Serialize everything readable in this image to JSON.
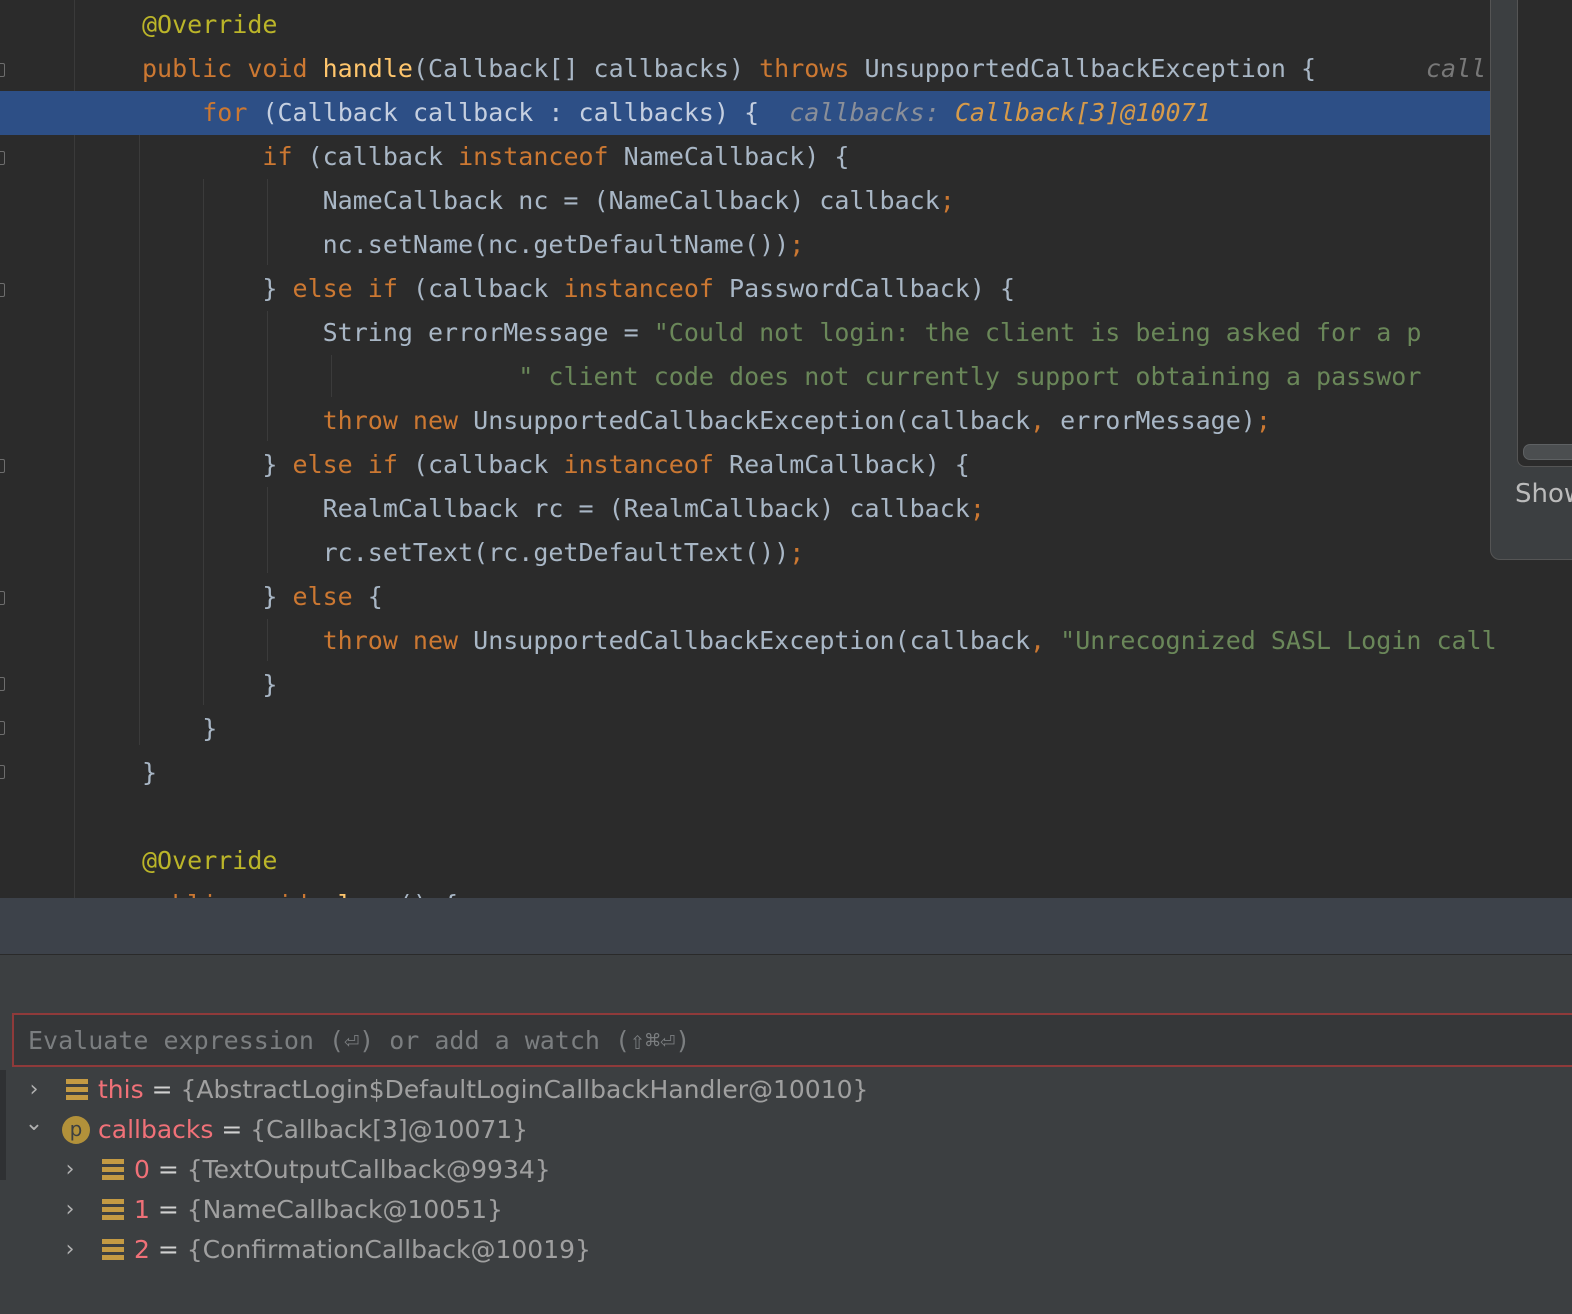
{
  "editor": {
    "lines": [
      {
        "id": "l1",
        "parts": [
          [
            "ann",
            "@Override"
          ]
        ]
      },
      {
        "id": "l2",
        "parts": [
          [
            "kw",
            "public "
          ],
          [
            "kw",
            "void "
          ],
          [
            "fn",
            "handle"
          ],
          [
            "",
            "(Callback[] callbacks) "
          ],
          [
            "kw",
            "throws "
          ],
          [
            "",
            "UnsupportedCallbackException {"
          ]
        ],
        "hint_right": "call"
      },
      {
        "id": "l3",
        "parts": [
          [
            "",
            "    "
          ],
          [
            "kw",
            "for "
          ],
          [
            "",
            "(Callback callback : callbacks) {  "
          ],
          [
            "hint",
            "callbacks: "
          ],
          [
            "hint-val",
            "Callback[3]@10071"
          ]
        ]
      },
      {
        "id": "l4",
        "parts": [
          [
            "",
            "        "
          ],
          [
            "kw",
            "if "
          ],
          [
            "",
            "(callback "
          ],
          [
            "kw",
            "instanceof "
          ],
          [
            "",
            "NameCallback) {"
          ]
        ]
      },
      {
        "id": "l5",
        "parts": [
          [
            "",
            "            NameCallback nc = (NameCallback) callback"
          ],
          [
            "semi",
            ";"
          ]
        ]
      },
      {
        "id": "l6",
        "parts": [
          [
            "",
            "            nc.setName(nc.getDefaultName())"
          ],
          [
            "semi",
            ";"
          ]
        ]
      },
      {
        "id": "l7",
        "parts": [
          [
            "",
            "        } "
          ],
          [
            "kw",
            "else if "
          ],
          [
            "",
            "(callback "
          ],
          [
            "kw",
            "instanceof "
          ],
          [
            "",
            "PasswordCallback) {"
          ]
        ]
      },
      {
        "id": "l8",
        "parts": [
          [
            "",
            "            String errorMessage = "
          ],
          [
            "str",
            "\"Could not login: the client is being asked for a p"
          ]
        ]
      },
      {
        "id": "l9",
        "parts": [
          [
            "",
            "                         "
          ],
          [
            "str",
            "\" client code does not currently support obtaining a passwor"
          ]
        ]
      },
      {
        "id": "l10",
        "parts": [
          [
            "",
            "            "
          ],
          [
            "kw",
            "throw new "
          ],
          [
            "",
            "UnsupportedCallbackException(callback"
          ],
          [
            "semi",
            ", "
          ],
          [
            "",
            "errorMessage)"
          ],
          [
            "semi",
            ";"
          ]
        ]
      },
      {
        "id": "l11",
        "parts": [
          [
            "",
            "        } "
          ],
          [
            "kw",
            "else if "
          ],
          [
            "",
            "(callback "
          ],
          [
            "kw",
            "instanceof "
          ],
          [
            "",
            "RealmCallback) {"
          ]
        ]
      },
      {
        "id": "l12",
        "parts": [
          [
            "",
            "            RealmCallback rc = (RealmCallback) callback"
          ],
          [
            "semi",
            ";"
          ]
        ]
      },
      {
        "id": "l13",
        "parts": [
          [
            "",
            "            rc.setText(rc.getDefaultText())"
          ],
          [
            "semi",
            ";"
          ]
        ]
      },
      {
        "id": "l14",
        "parts": [
          [
            "",
            "        } "
          ],
          [
            "kw",
            "else "
          ],
          [
            "",
            "{"
          ]
        ]
      },
      {
        "id": "l15",
        "parts": [
          [
            "",
            "            "
          ],
          [
            "kw",
            "throw new "
          ],
          [
            "",
            "UnsupportedCallbackException(callback"
          ],
          [
            "semi",
            ", "
          ],
          [
            "str",
            "\"Unrecognized SASL Login call"
          ]
        ]
      },
      {
        "id": "l16",
        "parts": [
          [
            "",
            "        }"
          ]
        ]
      },
      {
        "id": "l17",
        "parts": [
          [
            "",
            "    }"
          ]
        ]
      },
      {
        "id": "l18",
        "parts": [
          [
            "",
            "}"
          ]
        ]
      },
      {
        "id": "l19",
        "parts": [
          [
            "",
            ""
          ]
        ]
      },
      {
        "id": "l20",
        "parts": [
          [
            "ann",
            "@Override"
          ]
        ]
      },
      {
        "id": "l21",
        "parts": [
          [
            "kw",
            "public "
          ],
          [
            "kw",
            "void "
          ],
          [
            "fn",
            "close"
          ],
          [
            "",
            "() {"
          ]
        ]
      }
    ],
    "execution_line": "l3"
  },
  "popup": {
    "label": "Show"
  },
  "debugger": {
    "eval_placeholder": "Evaluate expression (⏎) or add a watch (⇧⌘⏎)",
    "variables": [
      {
        "id": "v-this",
        "expanded": false,
        "icon": "field-icon",
        "name": "this",
        "eq": " = ",
        "value": "{AbstractLogin$DefaultLoginCallbackHandler@10010}"
      },
      {
        "id": "v-callbacks",
        "expanded": true,
        "icon": "param-icon",
        "icon_letter": "p",
        "name": "callbacks",
        "eq": " = ",
        "value": "{Callback[3]@10071}"
      },
      {
        "id": "v-0",
        "expanded": false,
        "icon": "field-icon",
        "name": "0",
        "eq": " = ",
        "value": "{TextOutputCallback@9934}"
      },
      {
        "id": "v-1",
        "expanded": false,
        "icon": "field-icon",
        "name": "1",
        "eq": " = ",
        "value": "{NameCallback@10051}"
      },
      {
        "id": "v-2",
        "expanded": false,
        "icon": "field-icon",
        "name": "2",
        "eq": " = ",
        "value": "{ConfirmationCallback@10019}"
      }
    ]
  },
  "colors": {
    "editor_bg": "#2b2b2b",
    "execution_line_bg": "#2d4f86",
    "keyword": "#cc7832",
    "annotation": "#bbb529",
    "method": "#ffc66d",
    "string": "#6a8759",
    "variable_name": "#f07178"
  }
}
